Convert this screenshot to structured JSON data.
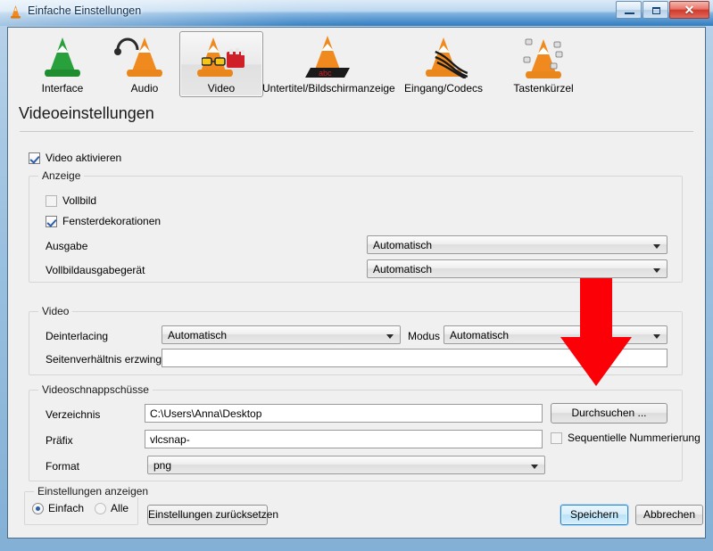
{
  "window": {
    "title": "Einfache Einstellungen",
    "icon": "vlc-cone-icon",
    "minimize_label": "",
    "maximize_label": "",
    "close_label": "✕"
  },
  "tabs": [
    {
      "id": "interface",
      "label": "Interface",
      "icon": "vlc-cone-green-icon",
      "selected": false
    },
    {
      "id": "audio",
      "label": "Audio",
      "icon": "vlc-cone-headphones-icon",
      "selected": false
    },
    {
      "id": "video",
      "label": "Video",
      "icon": "vlc-cone-film-icon",
      "selected": true
    },
    {
      "id": "subtitles",
      "label": "Untertitel/Bildschirmanzeige",
      "icon": "vlc-cone-subtitle-icon",
      "selected": false
    },
    {
      "id": "input",
      "label": "Eingang/Codecs",
      "icon": "vlc-cone-cables-icon",
      "selected": false
    },
    {
      "id": "hotkeys",
      "label": "Tastenkürzel",
      "icon": "vlc-cone-keys-icon",
      "selected": false
    }
  ],
  "page": {
    "heading": "Videoeinstellungen",
    "enable_video": {
      "label": "Video aktivieren",
      "checked": true
    }
  },
  "groups": {
    "display": {
      "title": "Anzeige",
      "fullscreen": {
        "label": "Vollbild",
        "checked": false
      },
      "window_decorations": {
        "label": "Fensterdekorationen",
        "checked": true
      },
      "output": {
        "label": "Ausgabe",
        "value": "Automatisch"
      },
      "fullscreen_device": {
        "label": "Vollbildausgabegerät",
        "value": "Automatisch"
      }
    },
    "video": {
      "title": "Video",
      "deinterlacing": {
        "label": "Deinterlacing",
        "value": "Automatisch"
      },
      "mode": {
        "label": "Modus",
        "value": "Automatisch"
      },
      "force_aspect": {
        "label": "Seitenverhältnis erzwingen",
        "value": "",
        "placeholder": ""
      }
    },
    "snapshots": {
      "title": "Videoschnappschüsse",
      "directory": {
        "label": "Verzeichnis",
        "value": "C:\\Users\\Anna\\Desktop"
      },
      "browse_button": "Durchsuchen ...",
      "prefix": {
        "label": "Präfix",
        "value": "vlcsnap-"
      },
      "sequential": {
        "label": "Sequentielle Nummerierung",
        "checked": false
      },
      "format": {
        "label": "Format",
        "value": "png"
      }
    }
  },
  "footer": {
    "show_settings": {
      "title": "Einstellungen anzeigen",
      "simple": {
        "label": "Einfach",
        "checked": true
      },
      "all": {
        "label": "Alle",
        "checked": false
      }
    },
    "reset_button": "Einstellungen zurücksetzen",
    "save_button": "Speichern",
    "cancel_button": "Abbrechen"
  },
  "annotation": {
    "arrow": "red-down-arrow",
    "color": "#fb0007",
    "points_at": "Durchsuchen ..."
  },
  "colors": {
    "accent": "#2c83c9",
    "window_frame": "#83b0d6",
    "client_bg": "#f0f0f0",
    "annotation_red": "#fb0007"
  }
}
